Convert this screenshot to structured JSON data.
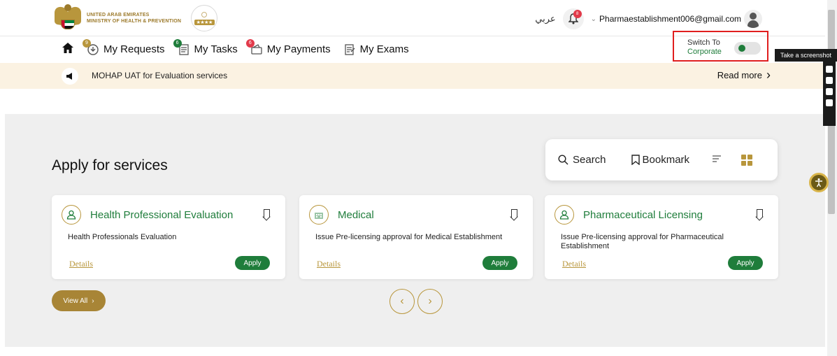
{
  "header": {
    "ministry_line1": "UNITED ARAB EMIRATES",
    "ministry_line2": "MINISTRY OF HEALTH & PREVENTION",
    "badge_stars": "★★★★",
    "language": "عربي",
    "notification_count": "8",
    "user_email": "Pharmaestablishment006@gmail.com"
  },
  "nav": {
    "items": [
      {
        "label": "My Requests",
        "badge": "9",
        "badge_color": "#b8963c"
      },
      {
        "label": "My Tasks",
        "badge": "6",
        "badge_color": "#1f7d3b"
      },
      {
        "label": "My Payments",
        "badge": "6",
        "badge_color": "#e23a4a"
      },
      {
        "label": "My Exams",
        "badge": ""
      }
    ]
  },
  "switch": {
    "label": "Switch To",
    "value": "Corporate"
  },
  "announcement": {
    "text": "MOHAP UAT for Evaluation services",
    "read_more": "Read more"
  },
  "main": {
    "title": "Apply for services",
    "toolbar": {
      "search": "Search",
      "bookmark": "Bookmark"
    },
    "cards": [
      {
        "title": "Health Professional Evaluation",
        "description": "Health Professionals Evaluation",
        "details": "Details",
        "apply": "Apply",
        "icon": "person-icon"
      },
      {
        "title": "Medical",
        "description": "Issue Pre-licensing approval for Medical Establishment",
        "details": "Details",
        "apply": "Apply",
        "icon": "building-icon"
      },
      {
        "title": "Pharmaceutical Licensing",
        "description": "Issue Pre-licensing approval for Pharmaceutical Establishment",
        "details": "Details",
        "apply": "Apply",
        "icon": "person-icon"
      }
    ],
    "view_all": "View All"
  },
  "screenshot_tool": {
    "tooltip": "Take a screenshot"
  },
  "colors": {
    "brand_gold": "#b8963c",
    "brand_green": "#1f7d3b",
    "highlight_red": "#e01e1e",
    "announcement_bg": "#fbf2e2"
  }
}
